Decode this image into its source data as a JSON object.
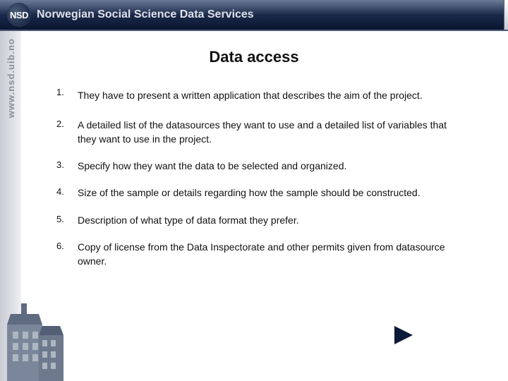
{
  "header": {
    "logo_text": "NSD",
    "org_name": "Norwegian Social Science Data Services"
  },
  "rail": {
    "url": "www.nsd.uib.no"
  },
  "title": "Data access",
  "items": [
    {
      "n": "1.",
      "text": "They have to present a written application that describes the aim of the project."
    },
    {
      "n": "2.",
      "text": "A detailed list of the datasources they want to use and a detailed list of variables that they want to use in the project."
    },
    {
      "n": "3.",
      "text": "Specify how they want the data to be selected and organized."
    },
    {
      "n": "4.",
      "text": "Size of the sample or details regarding how the sample should be constructed."
    },
    {
      "n": "5.",
      "text": "Description of what type of data format they prefer."
    },
    {
      "n": "6.",
      "text": "Copy of license from the Data Inspectorate and other permits given from datasource owner."
    }
  ]
}
